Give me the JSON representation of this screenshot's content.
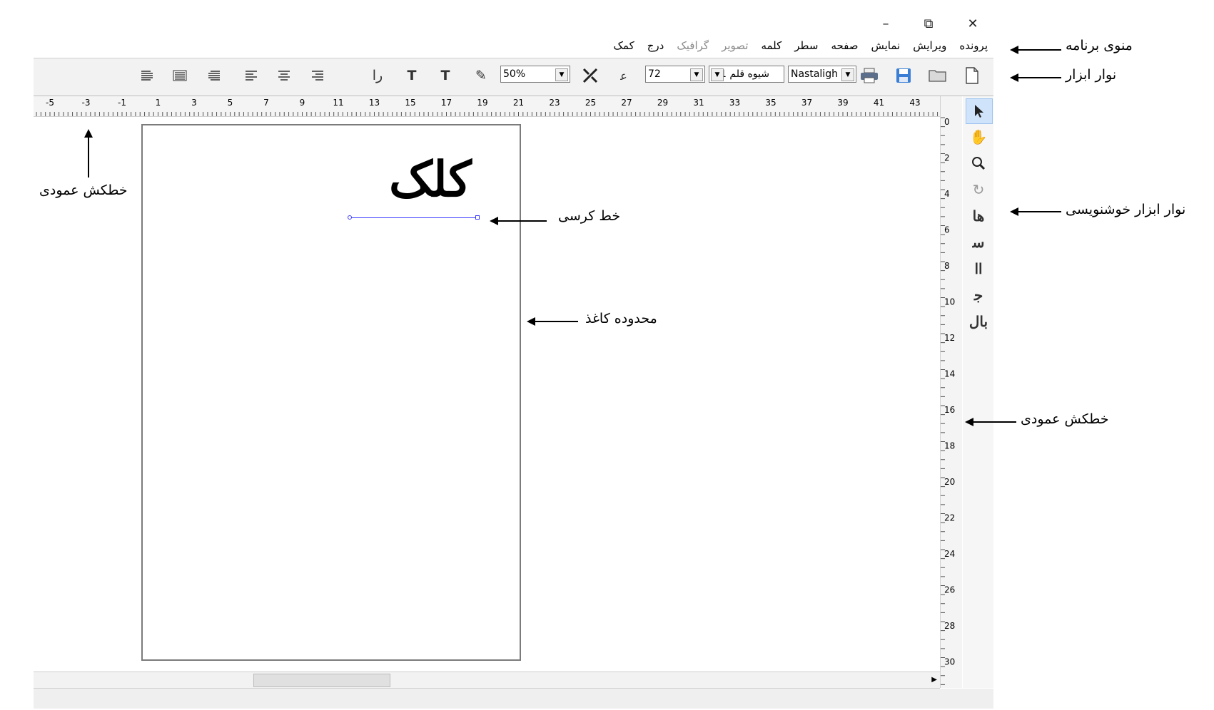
{
  "window_controls": {
    "minimize": "–",
    "restore": "⧉",
    "close": "✕"
  },
  "menu": {
    "items": [
      {
        "label": "پرونده",
        "enabled": true
      },
      {
        "label": "ویرایش",
        "enabled": true
      },
      {
        "label": "نمایش",
        "enabled": true
      },
      {
        "label": "صفحه",
        "enabled": true
      },
      {
        "label": "سطر",
        "enabled": true
      },
      {
        "label": "کلمه",
        "enabled": true
      },
      {
        "label": "تصویر",
        "enabled": false
      },
      {
        "label": "گرافیک",
        "enabled": false
      },
      {
        "label": "درج",
        "enabled": true
      },
      {
        "label": "کمک",
        "enabled": true
      }
    ]
  },
  "toolbar": {
    "font_select": "Nastaligh",
    "style_select": "شیوه قلم 1",
    "size_select": "72",
    "zoom_select": "50%"
  },
  "ruler": {
    "horizontal_ticks": [
      "-5",
      "-3",
      "-1",
      "1",
      "3",
      "5",
      "7",
      "9",
      "11",
      "13",
      "15",
      "17",
      "19",
      "21",
      "23",
      "25",
      "27",
      "29",
      "31",
      "33",
      "35",
      "37",
      "39",
      "41",
      "43"
    ],
    "vertical_ticks": [
      "0",
      "2",
      "4",
      "6",
      "8",
      "10",
      "12",
      "14",
      "16",
      "18",
      "20",
      "22",
      "24",
      "26",
      "28",
      "30"
    ]
  },
  "canvas": {
    "calligraphy_text": "کلک"
  },
  "callouts": {
    "program_menu": "منوی برنامه",
    "toolbar": "نوار ابزار",
    "calligraphy_toolbar": "نوار ابزار خوشنویسی",
    "vertical_ruler_right": "خطکش عمودی",
    "vertical_ruler_left": "خطکش عمودی",
    "baseline": "خط کرسی",
    "paper_area": "محدوده کاغذ"
  }
}
